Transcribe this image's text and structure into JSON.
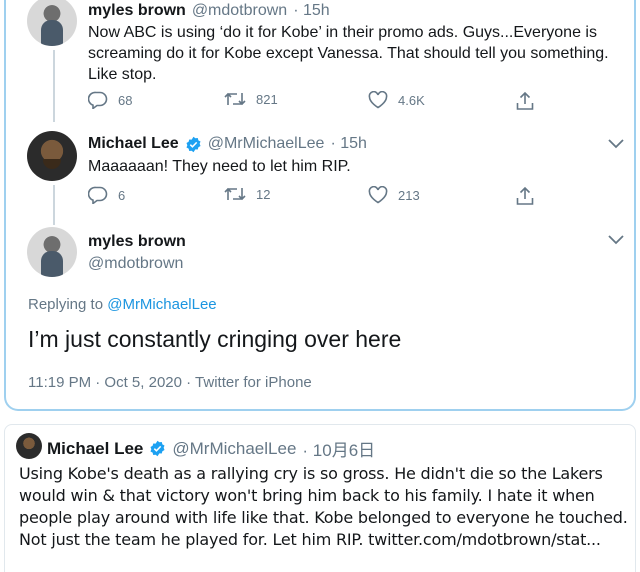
{
  "thread": {
    "tweet1": {
      "author_name": "myles brown",
      "author_handle": "@mdotbrown",
      "time": "· 15h",
      "text": "Now ABC is using ‘do it for Kobe’ in their promo ads. Guys...Everyone is screaming do it for Kobe except Vanessa. That should tell you something. Like stop.",
      "replies": "68",
      "retweets": "821",
      "likes": "4.6K"
    },
    "tweet2": {
      "author_name": "Michael Lee",
      "author_handle": "@MrMichaelLee",
      "time": "· 15h",
      "text": "Maaaaaan! They need to let him RIP.",
      "replies": "6",
      "retweets": "12",
      "likes": "213"
    },
    "tweet3": {
      "author_name": "myles brown",
      "author_handle": "@mdotbrown",
      "replying_prefix": "Replying to ",
      "replying_handle": "@MrMichaelLee",
      "text": "I’m just constantly cringing over here",
      "timestamp": "11:19 PM · Oct 5, 2020 · Twitter for iPhone"
    }
  },
  "quote": {
    "author_name": "Michael Lee",
    "author_handle": "@MrMichaelLee",
    "date": "· 10月6日",
    "text": "Using Kobe's death as a rallying cry is so gross. He didn't die so the Lakers would win & that victory won't bring him back to his family. I hate it when people play around with life like that. Kobe belonged to everyone he touched. Not just the team he played for. Let him RIP. twitter.com/mdotbrown/stat..."
  },
  "colors": {
    "accent": "#1b95e0",
    "muted": "#657786",
    "verified": "#1da1f2",
    "thread_border": "#9fd0ef"
  },
  "icons": [
    "reply-icon",
    "retweet-icon",
    "like-icon",
    "share-icon",
    "chevron-down-icon",
    "verified-badge-icon"
  ]
}
